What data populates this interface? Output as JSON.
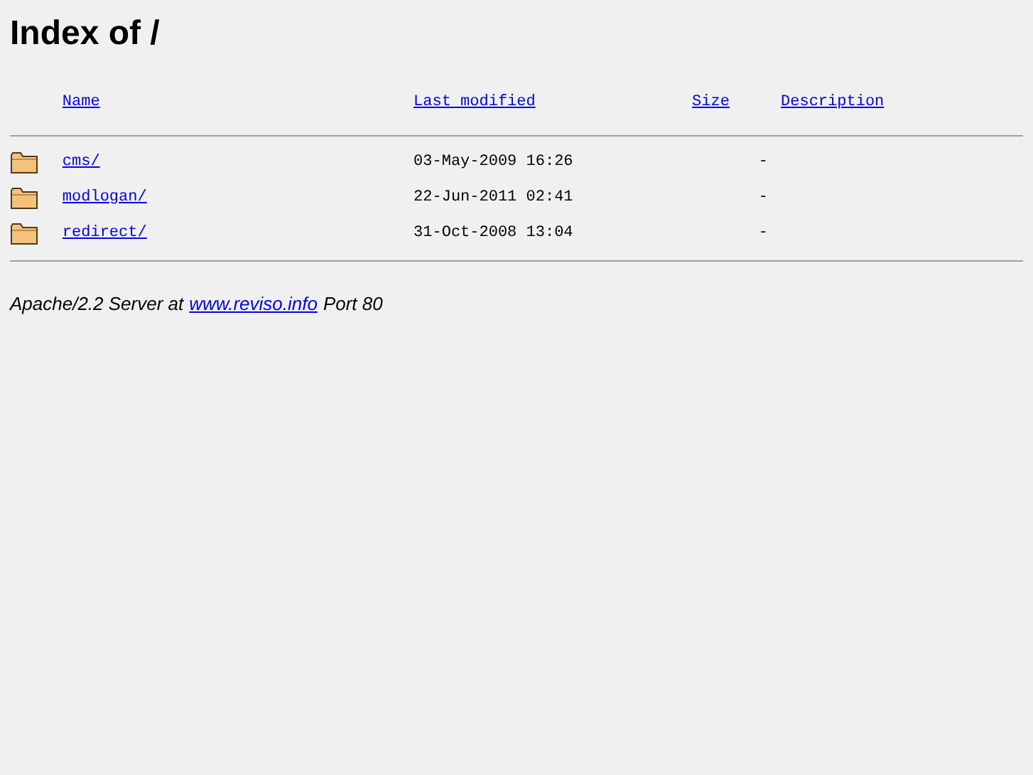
{
  "title": "Index of /",
  "columns": [
    {
      "label": "Name"
    },
    {
      "label": "Last modified"
    },
    {
      "label": "Size"
    },
    {
      "label": "Description"
    }
  ],
  "rows": [
    {
      "kind": "folder",
      "name": "cms/",
      "modified": "03-May-2009 16:26",
      "size": "-"
    },
    {
      "kind": "folder",
      "name": "modlogan/",
      "modified": "22-Jun-2011 02:41",
      "size": "-"
    },
    {
      "kind": "folder",
      "name": "redirect/",
      "modified": "31-Oct-2008 13:04",
      "size": "-"
    }
  ],
  "footer": {
    "before": "Apache/2.2 Server at",
    "link": "www.reviso.info",
    "after": "Port 80"
  }
}
